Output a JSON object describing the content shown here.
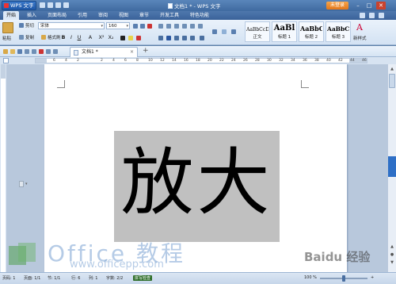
{
  "app": {
    "menu_button": "WPS 文字",
    "title": "文档1 * - WPS 文字",
    "login": "未登录"
  },
  "window_controls": [
    "–",
    "□",
    "✕"
  ],
  "menu_tabs": [
    "开始",
    "插入",
    "页面布局",
    "引用",
    "审阅",
    "视图",
    "章节",
    "开发工具",
    "特色功能"
  ],
  "ribbon": {
    "clipboard": {
      "paste": "粘贴",
      "cut": "剪切",
      "copy": "复制",
      "format_painter": "格式刷"
    },
    "font_name": "宋体",
    "font_size": "160",
    "format_buttons": [
      "B",
      "I",
      "U",
      "A",
      "X²",
      "X₂"
    ],
    "styles": [
      {
        "sample": "AaBbCcDd",
        "name": "正文"
      },
      {
        "sample": "AaBl",
        "name": "标题 1"
      },
      {
        "sample": "AaBbC",
        "name": "标题 2"
      },
      {
        "sample": "AaBbC",
        "name": "标题 3"
      }
    ],
    "new_style": "新样式"
  },
  "doc_tab": {
    "name": "文档1 *",
    "close": "×",
    "new": "+"
  },
  "ruler_numbers": [
    "6",
    "4",
    "2",
    "",
    "2",
    "4",
    "6",
    "8",
    "10",
    "12",
    "14",
    "16",
    "18",
    "20",
    "22",
    "24",
    "26",
    "28",
    "30",
    "32",
    "34",
    "36",
    "38",
    "40",
    "42",
    "44",
    "46"
  ],
  "document": {
    "big_text": "放大"
  },
  "watermark": {
    "brand": "Office 教程",
    "url": "www.officepp.com",
    "baidu": "Baidu 经验"
  },
  "status": {
    "page": "页码: 1",
    "pages": "页面: 1/1",
    "section": "节: 1/1",
    "row": "行: 6",
    "col": "列: 1",
    "words": "字数: 2/2",
    "spell": "拼写检查",
    "zoom": "100 %"
  }
}
